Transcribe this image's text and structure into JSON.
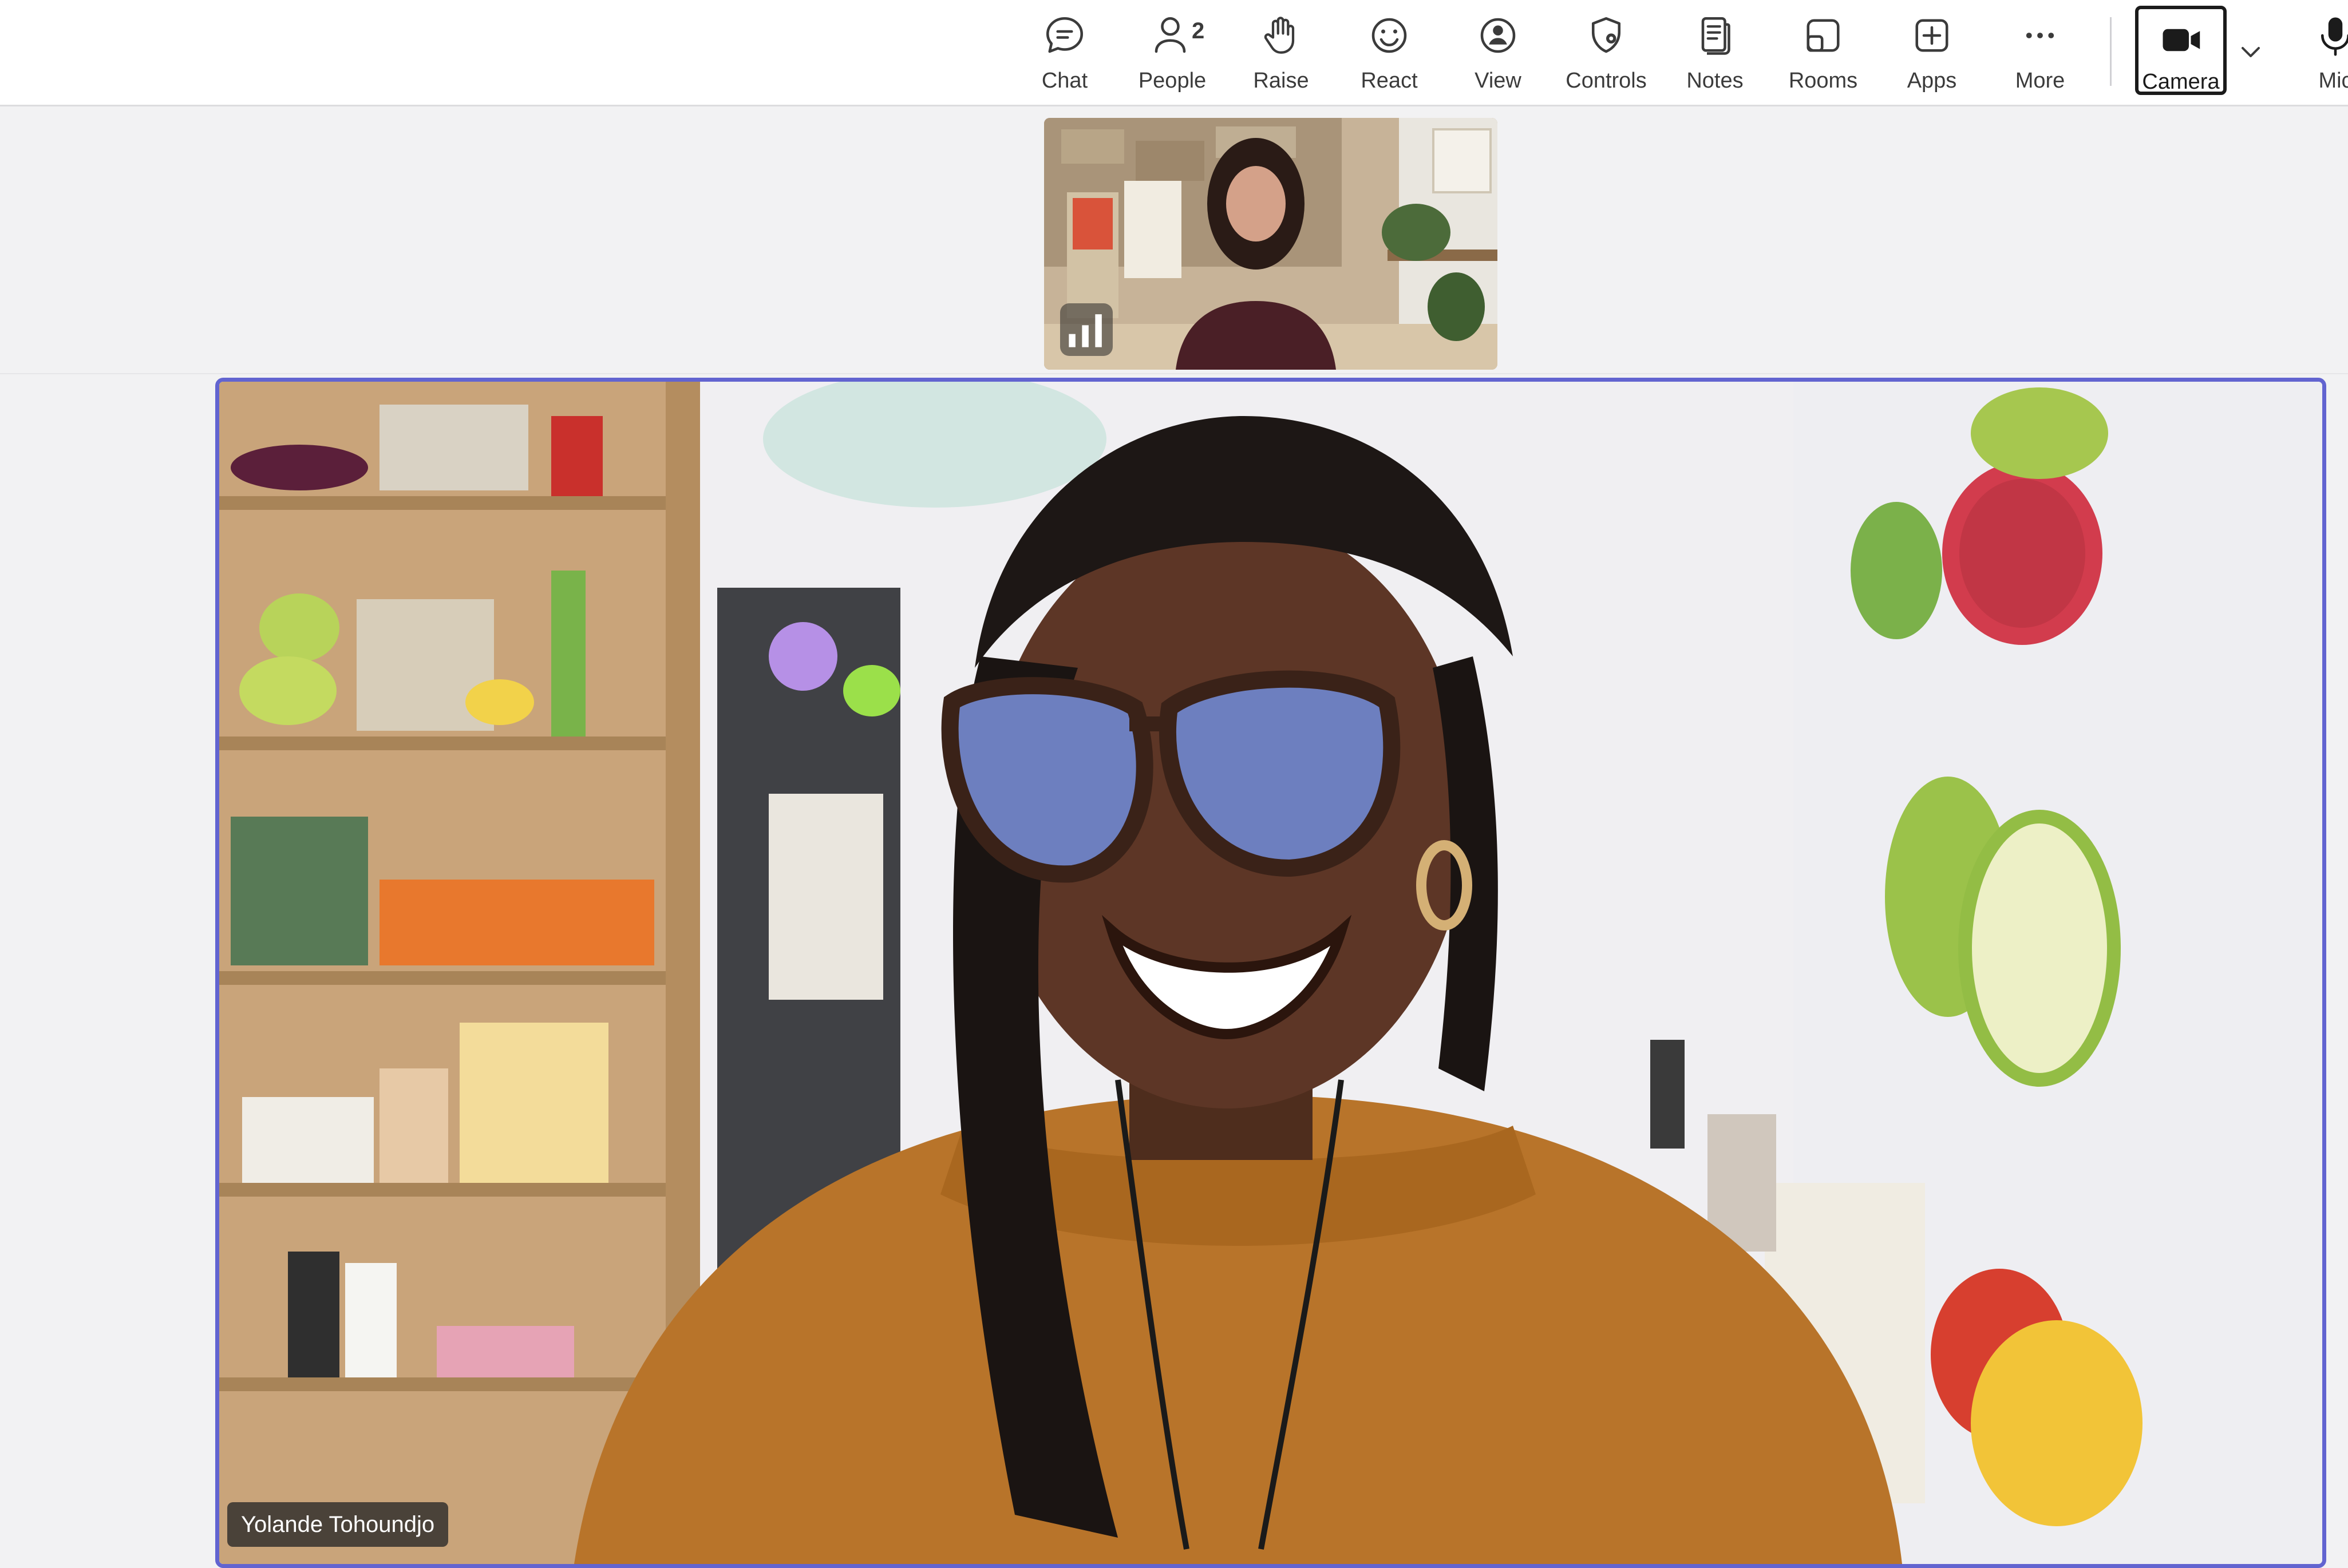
{
  "toolbar": {
    "items": [
      {
        "label": "Chat",
        "icon": "chat-bubble-icon"
      },
      {
        "label": "People",
        "icon": "person-icon",
        "count": "2"
      },
      {
        "label": "Raise",
        "icon": "raised-hand-icon"
      },
      {
        "label": "React",
        "icon": "smiley-icon"
      },
      {
        "label": "View",
        "icon": "view-person-icon"
      },
      {
        "label": "Controls",
        "icon": "shield-gear-icon"
      },
      {
        "label": "Notes",
        "icon": "notes-icon"
      },
      {
        "label": "Rooms",
        "icon": "rooms-icon"
      },
      {
        "label": "Apps",
        "icon": "plus-square-icon"
      },
      {
        "label": "More",
        "icon": "ellipsis-icon"
      }
    ],
    "camera": {
      "label": "Camera",
      "icon": "video-camera-icon",
      "state": "on"
    },
    "mic": {
      "label": "Mic",
      "icon": "microphone-icon"
    }
  },
  "secondary_tile": {
    "icon": "signal-bars-icon"
  },
  "main_tile": {
    "participant_name": "Yolande Tohoundjo",
    "accent": "#6264d0"
  }
}
